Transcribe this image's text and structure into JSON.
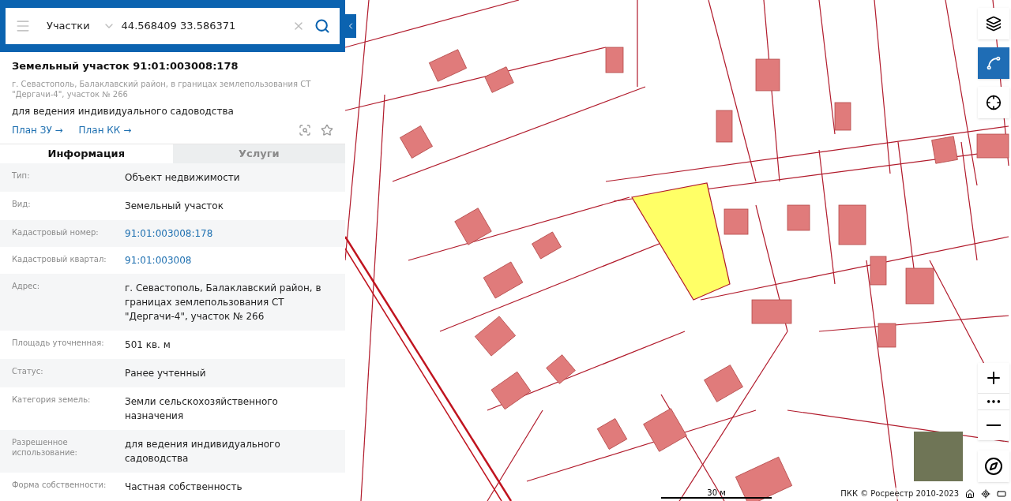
{
  "search": {
    "layer": "Участки",
    "query": "44.568409 33.586371"
  },
  "object": {
    "title": "Земельный участок 91:01:003008:178",
    "address": "г. Севастополь, Балаклавский район, в границах землепользования СТ \"Дергачи-4\", участок № 266",
    "purpose": "для ведения индивидуального садоводства",
    "links": [
      "План ЗУ →",
      "План КК →"
    ]
  },
  "tabs": [
    {
      "label": "Информация",
      "selected": true
    },
    {
      "label": "Услуги",
      "selected": false
    }
  ],
  "rows": [
    {
      "label": "Тип:",
      "value": "Объект недвижимости",
      "kind": "text"
    },
    {
      "label": "Вид:",
      "value": "Земельный участок",
      "kind": "text"
    },
    {
      "label": "Кадастровый номер:",
      "value": "91:01:003008:178",
      "kind": "link"
    },
    {
      "label": "Кадастровый квартал:",
      "value": "91:01:003008",
      "kind": "link"
    },
    {
      "label": "Адрес:",
      "value": "г. Севастополь, Балаклавский район, в границах землепользования СТ \"Дергачи-4\", участок № 266",
      "kind": "text"
    },
    {
      "label": "Площадь уточненная:",
      "value": "501 кв. м",
      "kind": "text"
    },
    {
      "label": "Статус:",
      "value": "Ранее учтенный",
      "kind": "text"
    },
    {
      "label": "Категория земель:",
      "value": "Земли сельскохозяйственного назначения",
      "kind": "text"
    },
    {
      "label": "Разрешенное использование:",
      "value": "для ведения индивидуального садоводства",
      "kind": "text"
    },
    {
      "label": "Форма собственности:",
      "value": "Частная собственность",
      "kind": "text"
    }
  ],
  "map": {
    "scale": "30 м",
    "attribution": "ПКК © Росреестр 2010-2023",
    "zoom_more": "•••",
    "measure_active": true
  }
}
